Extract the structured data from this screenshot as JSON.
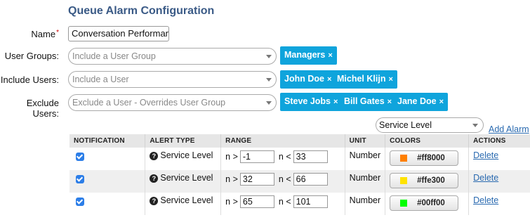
{
  "page_title": "Queue Alarm Configuration",
  "form": {
    "name_label": "Name",
    "name_value": "Conversation Performanc",
    "user_groups_label": "User Groups:",
    "user_groups_placeholder": "Include a User Group",
    "user_groups_tags": [
      "Managers"
    ],
    "include_users_label": "Include Users:",
    "include_users_placeholder": "Include a User",
    "include_users_tags": [
      "John Doe",
      "Michel Klijn"
    ],
    "exclude_users_label": "Exclude Users:",
    "exclude_users_placeholder": "Exclude a User - Overrides User Group",
    "exclude_users_tags": [
      "Steve Jobs",
      "Bill Gates",
      "Jane Doe"
    ],
    "tag_remove_glyph": "×"
  },
  "alarm_select": {
    "value": "Service Level"
  },
  "add_alarm_link": "Add Alarm",
  "table": {
    "headers": [
      "NOTIFICATION",
      "ALERT TYPE",
      "RANGE",
      "UNIT",
      "COLORS",
      "ACTIONS"
    ],
    "range_gt_label": "n >",
    "range_lt_label": "n <",
    "help_glyph": "?",
    "rows": [
      {
        "checked": true,
        "alert_type": "Service Level",
        "min": "-1",
        "max": "33",
        "unit": "Number",
        "color": "#ff8000",
        "action": "Delete"
      },
      {
        "checked": true,
        "alert_type": "Service Level",
        "min": "32",
        "max": "66",
        "unit": "Number",
        "color": "#ffe300",
        "action": "Delete"
      },
      {
        "checked": true,
        "alert_type": "Service Level",
        "min": "65",
        "max": "101",
        "unit": "Number",
        "color": "#00ff00",
        "action": "Delete"
      }
    ]
  },
  "colors": {
    "title": "#3a5a86",
    "tag_bg": "#0fa4dc",
    "link": "#2a6ab0",
    "checkbox": "#2c7ee8"
  }
}
